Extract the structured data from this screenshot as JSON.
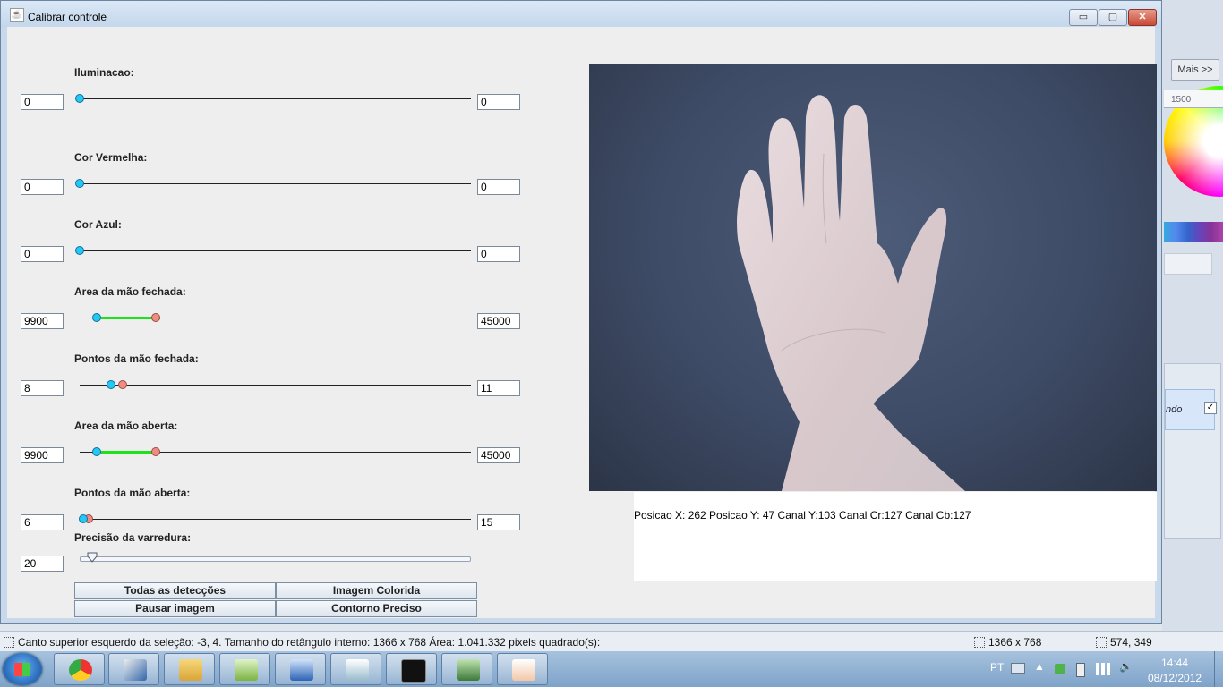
{
  "window": {
    "title": "Calibrar controle",
    "min": "▭",
    "max": "▢",
    "close": "✕"
  },
  "sliders": [
    {
      "label": "Iluminacao:",
      "min_value": "0",
      "max_value": "0"
    },
    {
      "label": "Cor Vermelha:",
      "min_value": "0",
      "max_value": "0"
    },
    {
      "label": "Cor Azul:",
      "min_value": "0",
      "max_value": "0"
    },
    {
      "label": "Area da mão fechada:",
      "min_value": "9900",
      "max_value": "45000"
    },
    {
      "label": "Pontos da mão fechada:",
      "min_value": "8",
      "max_value": "11"
    },
    {
      "label": "Area da mão aberta:",
      "min_value": "9900",
      "max_value": "45000"
    },
    {
      "label": "Pontos da mão aberta:",
      "min_value": "6",
      "max_value": "15"
    }
  ],
  "precision": {
    "label": "Precisão da varredura:",
    "value": "20"
  },
  "buttons": {
    "all_detections": "Todas as detecções",
    "colored_image": "Imagem Colorida",
    "pause_image": "Pausar imagem",
    "precise_contour": "Contorno Preciso"
  },
  "camera": {
    "info": "Posicao X: 262 Posicao Y: 47 Canal Y:103 Canal Cr:127 Canal Cb:127"
  },
  "background_app": {
    "more_label": "Mais >>",
    "ruler_label": "1500",
    "panel_item": "ndo",
    "check": "✓"
  },
  "statusbar": {
    "selection": "Canto superior esquerdo da seleção: -3, 4. Tamanho do retângulo interno: 1366 x 768 Área: 1.041.332 pixels quadrado(s):",
    "size": "1366 x 768",
    "cursor": "574, 349"
  },
  "taskbar": {
    "language": "PT",
    "time": "14:44",
    "date": "08/12/2012"
  },
  "colors": {
    "accent_blue": "#23c9f2",
    "accent_red": "#f18c83",
    "range_green": "#1de31d"
  }
}
